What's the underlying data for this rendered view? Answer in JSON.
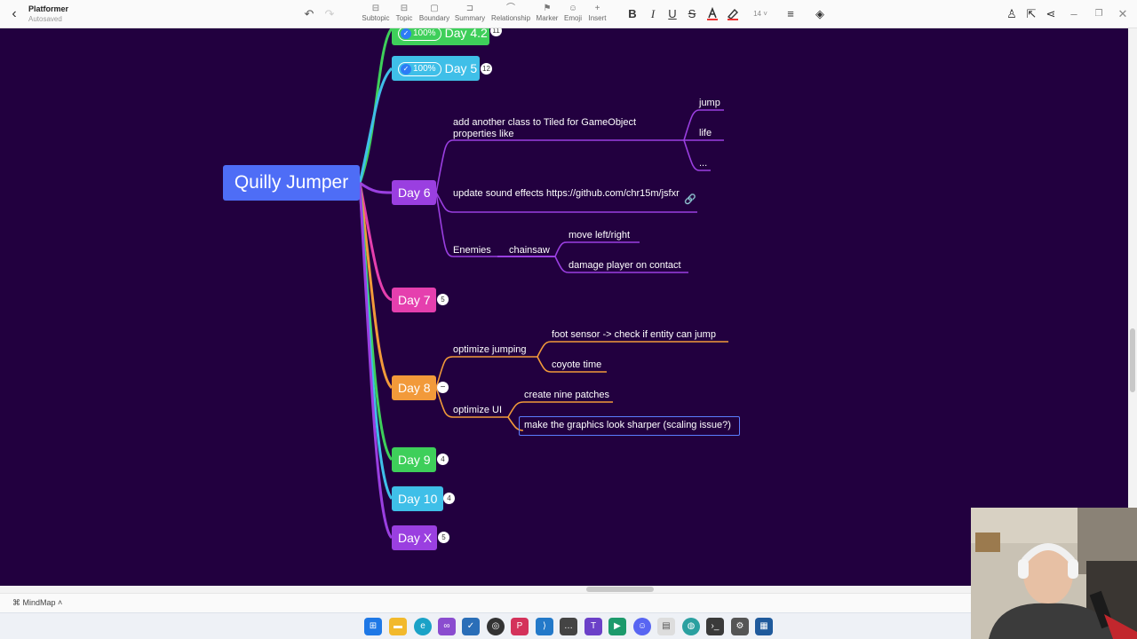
{
  "app": {
    "title": "Platformer",
    "save_status": "Autosaved"
  },
  "toolbar": {
    "items": [
      {
        "label": "Subtopic",
        "icon": "subtopic-icon"
      },
      {
        "label": "Topic",
        "icon": "topic-icon"
      },
      {
        "label": "Boundary",
        "icon": "boundary-icon"
      },
      {
        "label": "Summary",
        "icon": "summary-icon"
      },
      {
        "label": "Relationship",
        "icon": "relationship-icon"
      },
      {
        "label": "Marker",
        "icon": "marker-icon"
      },
      {
        "label": "Emoji",
        "icon": "emoji-icon"
      },
      {
        "label": "Insert",
        "icon": "insert-icon"
      }
    ],
    "format": {
      "bold": "B",
      "italic": "I",
      "underline": "U",
      "strike": "S",
      "font_size": "14"
    }
  },
  "mindmap": {
    "root": "Quilly Jumper",
    "days": [
      {
        "label": "Day 4.2",
        "color": "#3ecf5a",
        "progress": "100%",
        "badge": "11"
      },
      {
        "label": "Day 5",
        "color": "#3fbfe8",
        "progress": "100%",
        "badge": "12"
      },
      {
        "label": "Day 6",
        "color": "#9a3fe0"
      },
      {
        "label": "Day 7",
        "color": "#e53fae",
        "badge": "5"
      },
      {
        "label": "Day 8",
        "color": "#f29a3a",
        "badge": "−"
      },
      {
        "label": "Day 9",
        "color": "#3ecf5a",
        "badge": "4"
      },
      {
        "label": "Day 10",
        "color": "#3fbfe8",
        "badge": "4"
      },
      {
        "label": "Day X",
        "color": "#9a3fe0",
        "badge": "5"
      }
    ],
    "day6": {
      "tiled_class": "add another class to Tiled for GameObject properties like",
      "tiled_props": [
        "jump",
        "life",
        "..."
      ],
      "sound": "update sound effects https://github.com/chr15m/jsfxr",
      "enemies": "Enemies",
      "chainsaw": "chainsaw",
      "chainsaw_children": [
        "move left/right",
        "damage player on contact"
      ]
    },
    "day8": {
      "jumping": "optimize jumping",
      "jumping_children": [
        "foot sensor -> check if entity can jump",
        "coyote time"
      ],
      "ui": "optimize UI",
      "ui_children": [
        "create nine patches",
        "make the graphics look sharper (scaling issue?)"
      ]
    }
  },
  "statusbar": {
    "mode": "MindMap"
  }
}
